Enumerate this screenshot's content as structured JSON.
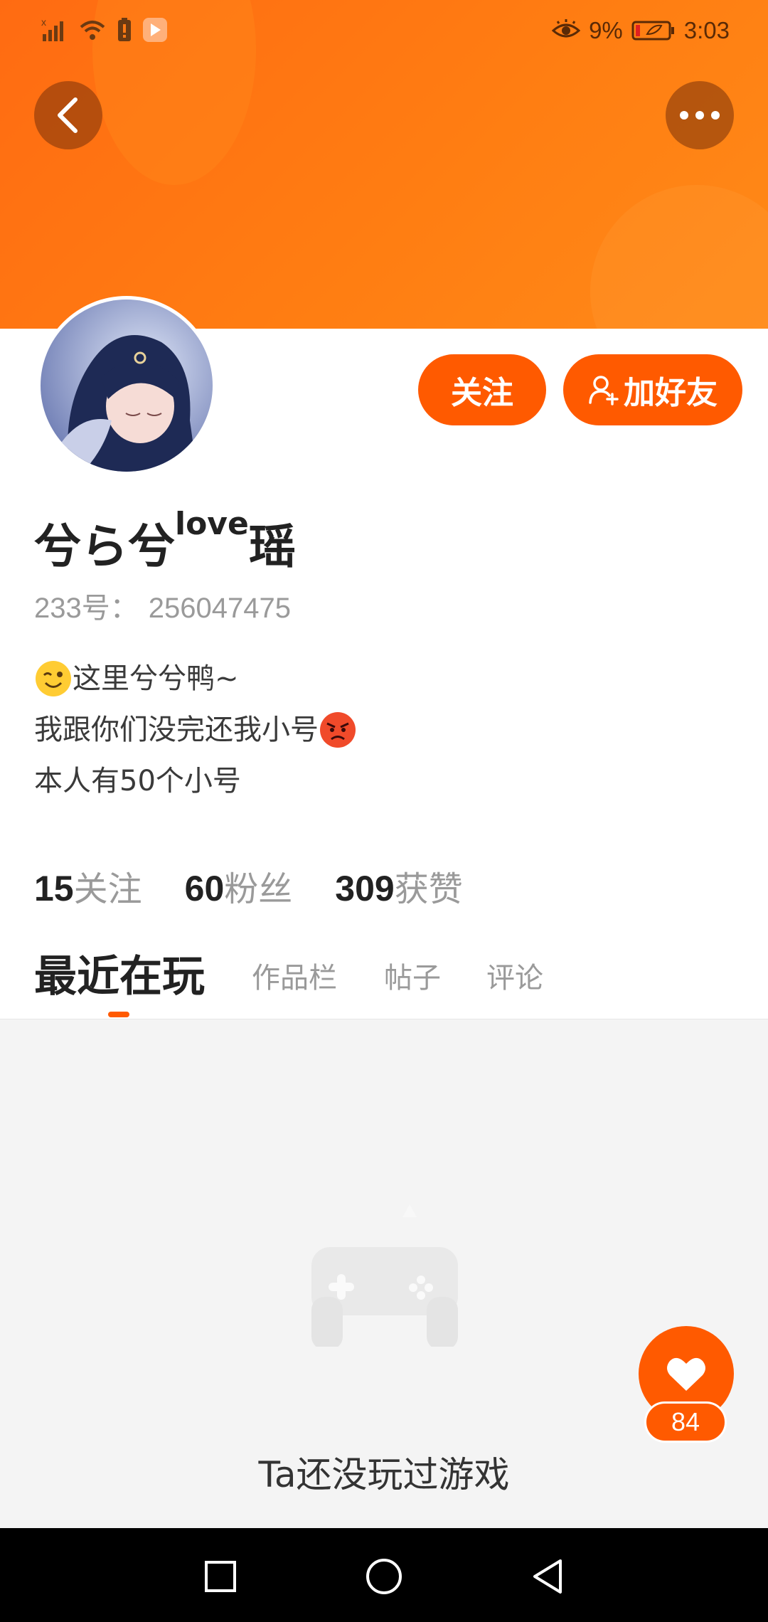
{
  "status_bar": {
    "battery_percent": "9%",
    "time": "3:03",
    "icons": [
      "signal-icon",
      "wifi-icon",
      "battery-alert-icon",
      "app-notification-icon",
      "eye-comfort-icon",
      "battery-icon"
    ]
  },
  "header": {
    "back_icon": "chevron-left-icon",
    "more_icon": "more-dots-icon",
    "background_color": "#ff7a14"
  },
  "actions": {
    "follow_label": "关注",
    "add_friend_label": "加好友",
    "accent_color": "#ff5a00"
  },
  "profile": {
    "name_main": "兮ら兮",
    "name_sup": "love",
    "name_tail": "瑶",
    "id_label": "233号：",
    "id_value": "256047475",
    "bio": [
      "这里兮兮鸭~",
      "我跟你们没完还我小号",
      "本人有50个小号"
    ]
  },
  "stats": [
    {
      "num": "15",
      "label": "关注"
    },
    {
      "num": "60",
      "label": "粉丝"
    },
    {
      "num": "309",
      "label": "获赞"
    }
  ],
  "tabs": [
    {
      "label": "最近在玩",
      "active": true
    },
    {
      "label": "作品栏",
      "active": false
    },
    {
      "label": "帖子",
      "active": false
    },
    {
      "label": "评论",
      "active": false
    }
  ],
  "content": {
    "empty_icon": "gamepad-icon",
    "empty_text": "Ta还没玩过游戏"
  },
  "like": {
    "icon": "heart-icon",
    "count": "84"
  },
  "nav": {
    "icons": [
      "recent-apps-icon",
      "home-icon",
      "back-icon"
    ]
  }
}
